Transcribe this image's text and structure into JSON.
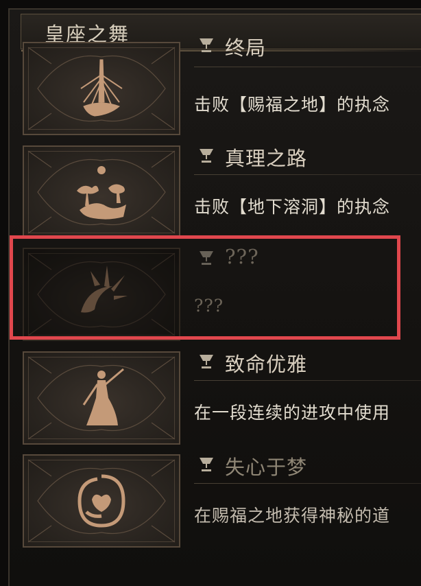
{
  "header": {
    "title": "皇座之舞"
  },
  "achievements": [
    {
      "title": "终局",
      "description": "击败【赐福之地】的执念"
    },
    {
      "title": "真理之路",
      "description": "击败【地下溶洞】的执念"
    },
    {
      "title": "???",
      "description": "???"
    },
    {
      "title": "致命优雅",
      "description": "在一段连续的进攻中使用"
    },
    {
      "title": "失心于梦",
      "description": "在赐福之地获得神秘的道"
    }
  ],
  "icons": [
    "tower-sunburst-icon",
    "tree-path-icon",
    "crescent-spikes-icon",
    "dancer-figure-icon",
    "swirl-heart-icon"
  ],
  "colors": {
    "highlight": "#e0474d",
    "text": "#e2dccf",
    "border": "#57493b"
  }
}
